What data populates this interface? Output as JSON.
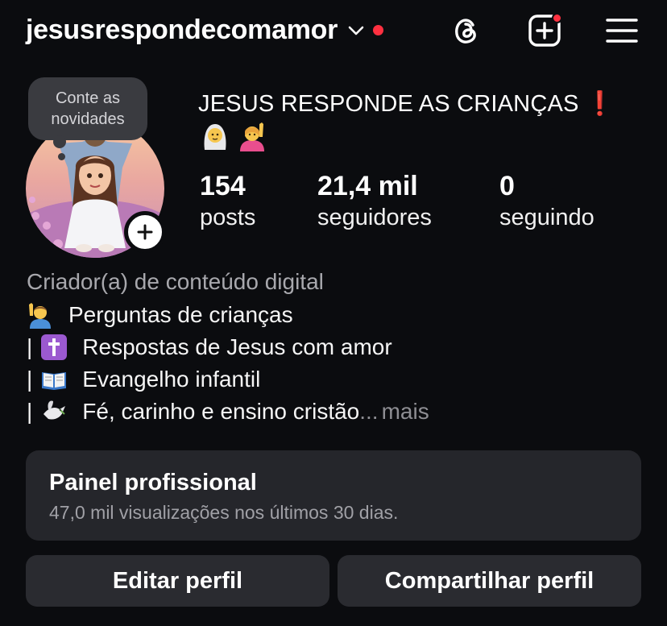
{
  "header": {
    "username": "jesusrespondecomamor",
    "icons": [
      "chevron-down-icon",
      "threads-icon",
      "create-icon",
      "menu-icon"
    ],
    "notification_color": "#ff3040"
  },
  "profile": {
    "note": "Conte as novidades",
    "display_name": "JESUS RESPONDE AS CRIANÇAS",
    "display_name_suffix": "❗",
    "stats": {
      "posts_count": "154",
      "posts_label": "posts",
      "followers_count": "21,4 mil",
      "followers_label": "seguidores",
      "following_count": "0",
      "following_label": "seguindo"
    }
  },
  "bio": {
    "category": "Criador(a) de conteúdo digital",
    "lines": [
      {
        "prefix": "",
        "emoji": "person-raising-hand-emoji",
        "text": "Perguntas de crianças"
      },
      {
        "prefix": "|",
        "emoji": "latin-cross-emoji",
        "text": "Respostas de Jesus com amor"
      },
      {
        "prefix": "|",
        "emoji": "open-book-emoji",
        "text": "Evangelho infantil"
      },
      {
        "prefix": "|",
        "emoji": "dove-emoji",
        "text": "Fé, carinho e ensino cristão"
      }
    ],
    "ellipsis": "...",
    "more_label": "mais"
  },
  "dashboard": {
    "title": "Painel profissional",
    "subtitle": "47,0 mil visualizações nos últimos 30 dias."
  },
  "actions": {
    "edit_label": "Editar perfil",
    "share_label": "Compartilhar perfil"
  },
  "colors": {
    "background": "#0b0c0f",
    "card": "#25262b",
    "button": "#2a2b30",
    "accent_red": "#e8252d"
  }
}
